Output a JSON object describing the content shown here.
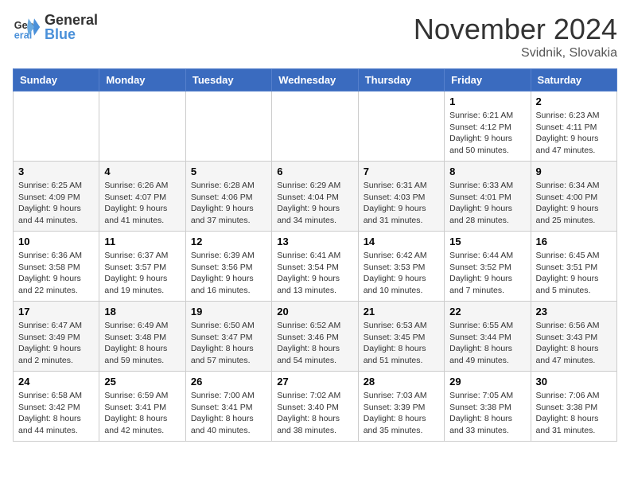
{
  "logo": {
    "line1": "General",
    "line2": "Blue"
  },
  "header": {
    "month": "November 2024",
    "location": "Svidnik, Slovakia"
  },
  "weekdays": [
    "Sunday",
    "Monday",
    "Tuesday",
    "Wednesday",
    "Thursday",
    "Friday",
    "Saturday"
  ],
  "weeks": [
    [
      {
        "day": "",
        "info": ""
      },
      {
        "day": "",
        "info": ""
      },
      {
        "day": "",
        "info": ""
      },
      {
        "day": "",
        "info": ""
      },
      {
        "day": "",
        "info": ""
      },
      {
        "day": "1",
        "info": "Sunrise: 6:21 AM\nSunset: 4:12 PM\nDaylight: 9 hours and 50 minutes."
      },
      {
        "day": "2",
        "info": "Sunrise: 6:23 AM\nSunset: 4:11 PM\nDaylight: 9 hours and 47 minutes."
      }
    ],
    [
      {
        "day": "3",
        "info": "Sunrise: 6:25 AM\nSunset: 4:09 PM\nDaylight: 9 hours and 44 minutes."
      },
      {
        "day": "4",
        "info": "Sunrise: 6:26 AM\nSunset: 4:07 PM\nDaylight: 9 hours and 41 minutes."
      },
      {
        "day": "5",
        "info": "Sunrise: 6:28 AM\nSunset: 4:06 PM\nDaylight: 9 hours and 37 minutes."
      },
      {
        "day": "6",
        "info": "Sunrise: 6:29 AM\nSunset: 4:04 PM\nDaylight: 9 hours and 34 minutes."
      },
      {
        "day": "7",
        "info": "Sunrise: 6:31 AM\nSunset: 4:03 PM\nDaylight: 9 hours and 31 minutes."
      },
      {
        "day": "8",
        "info": "Sunrise: 6:33 AM\nSunset: 4:01 PM\nDaylight: 9 hours and 28 minutes."
      },
      {
        "day": "9",
        "info": "Sunrise: 6:34 AM\nSunset: 4:00 PM\nDaylight: 9 hours and 25 minutes."
      }
    ],
    [
      {
        "day": "10",
        "info": "Sunrise: 6:36 AM\nSunset: 3:58 PM\nDaylight: 9 hours and 22 minutes."
      },
      {
        "day": "11",
        "info": "Sunrise: 6:37 AM\nSunset: 3:57 PM\nDaylight: 9 hours and 19 minutes."
      },
      {
        "day": "12",
        "info": "Sunrise: 6:39 AM\nSunset: 3:56 PM\nDaylight: 9 hours and 16 minutes."
      },
      {
        "day": "13",
        "info": "Sunrise: 6:41 AM\nSunset: 3:54 PM\nDaylight: 9 hours and 13 minutes."
      },
      {
        "day": "14",
        "info": "Sunrise: 6:42 AM\nSunset: 3:53 PM\nDaylight: 9 hours and 10 minutes."
      },
      {
        "day": "15",
        "info": "Sunrise: 6:44 AM\nSunset: 3:52 PM\nDaylight: 9 hours and 7 minutes."
      },
      {
        "day": "16",
        "info": "Sunrise: 6:45 AM\nSunset: 3:51 PM\nDaylight: 9 hours and 5 minutes."
      }
    ],
    [
      {
        "day": "17",
        "info": "Sunrise: 6:47 AM\nSunset: 3:49 PM\nDaylight: 9 hours and 2 minutes."
      },
      {
        "day": "18",
        "info": "Sunrise: 6:49 AM\nSunset: 3:48 PM\nDaylight: 8 hours and 59 minutes."
      },
      {
        "day": "19",
        "info": "Sunrise: 6:50 AM\nSunset: 3:47 PM\nDaylight: 8 hours and 57 minutes."
      },
      {
        "day": "20",
        "info": "Sunrise: 6:52 AM\nSunset: 3:46 PM\nDaylight: 8 hours and 54 minutes."
      },
      {
        "day": "21",
        "info": "Sunrise: 6:53 AM\nSunset: 3:45 PM\nDaylight: 8 hours and 51 minutes."
      },
      {
        "day": "22",
        "info": "Sunrise: 6:55 AM\nSunset: 3:44 PM\nDaylight: 8 hours and 49 minutes."
      },
      {
        "day": "23",
        "info": "Sunrise: 6:56 AM\nSunset: 3:43 PM\nDaylight: 8 hours and 47 minutes."
      }
    ],
    [
      {
        "day": "24",
        "info": "Sunrise: 6:58 AM\nSunset: 3:42 PM\nDaylight: 8 hours and 44 minutes."
      },
      {
        "day": "25",
        "info": "Sunrise: 6:59 AM\nSunset: 3:41 PM\nDaylight: 8 hours and 42 minutes."
      },
      {
        "day": "26",
        "info": "Sunrise: 7:00 AM\nSunset: 3:41 PM\nDaylight: 8 hours and 40 minutes."
      },
      {
        "day": "27",
        "info": "Sunrise: 7:02 AM\nSunset: 3:40 PM\nDaylight: 8 hours and 38 minutes."
      },
      {
        "day": "28",
        "info": "Sunrise: 7:03 AM\nSunset: 3:39 PM\nDaylight: 8 hours and 35 minutes."
      },
      {
        "day": "29",
        "info": "Sunrise: 7:05 AM\nSunset: 3:38 PM\nDaylight: 8 hours and 33 minutes."
      },
      {
        "day": "30",
        "info": "Sunrise: 7:06 AM\nSunset: 3:38 PM\nDaylight: 8 hours and 31 minutes."
      }
    ]
  ]
}
